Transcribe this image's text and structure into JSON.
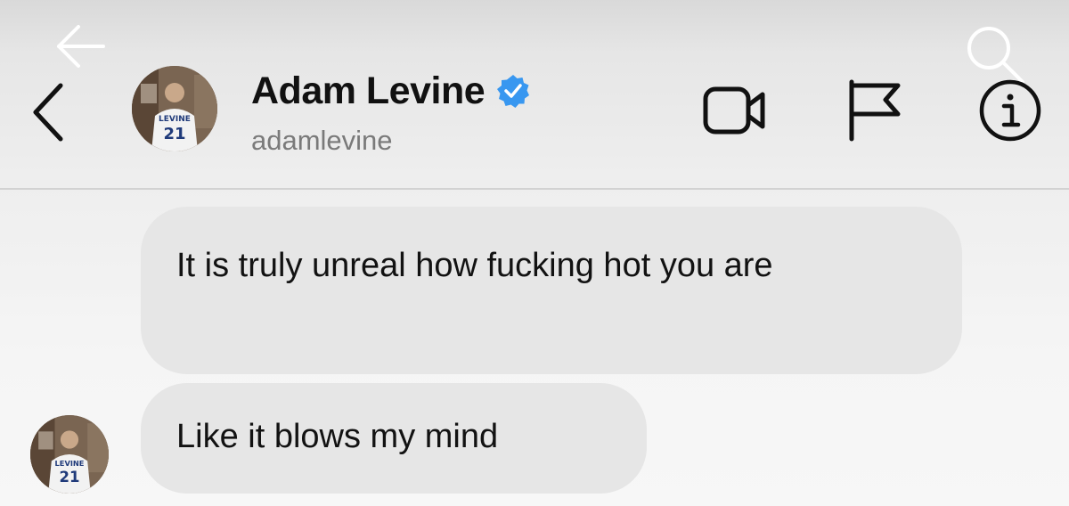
{
  "header": {
    "display_name": "Adam Levine",
    "username": "adamlevine",
    "verified": true,
    "icons": {
      "back": "chevron-left-icon",
      "video": "video-camera-icon",
      "flag": "flag-icon",
      "info": "info-icon",
      "overlay_back": "arrow-left-icon",
      "overlay_search": "search-icon"
    }
  },
  "avatar": {
    "jersey_name": "LEVINE",
    "jersey_number": "21"
  },
  "messages": [
    {
      "text": "It is truly unreal how fucking hot you are"
    },
    {
      "text": "Like it blows my mind"
    }
  ],
  "colors": {
    "verified_blue": "#3897f0",
    "bubble_bg": "#e6e6e6",
    "username_gray": "#7a7a7a"
  }
}
